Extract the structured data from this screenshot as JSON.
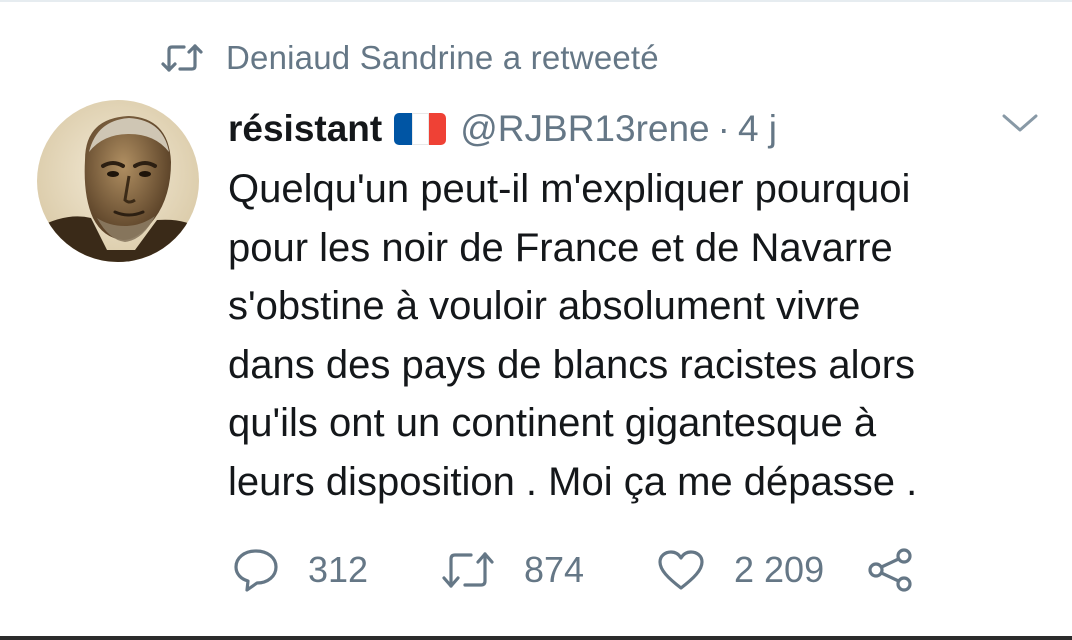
{
  "retweet_context": {
    "icon": "retweet-icon",
    "text": "Deniaud Sandrine a retweeté"
  },
  "tweet": {
    "author": {
      "display_name": "résistant",
      "emoji": "flag-france",
      "handle": "@RJBR13rene",
      "separator": "·",
      "age": "4 j"
    },
    "menu_icon": "chevron-down-icon",
    "lines": [
      "Quelqu'un peut-il m'expliquer pourquoi",
      "pour les noir de France et de Navarre",
      "s'obstine à vouloir absolument vivre",
      "dans des pays de blancs racistes alors",
      "qu'ils ont un continent gigantesque à",
      "leurs disposition . Moi ça me dépasse ."
    ]
  },
  "actions": {
    "reply_count": "312",
    "retweet_count": "874",
    "like_count": "2 209"
  },
  "colors": {
    "text": "#14171a",
    "muted": "#657786",
    "flag_blue": "#0055a4",
    "flag_white": "#ffffff",
    "flag_red": "#ef4135"
  }
}
